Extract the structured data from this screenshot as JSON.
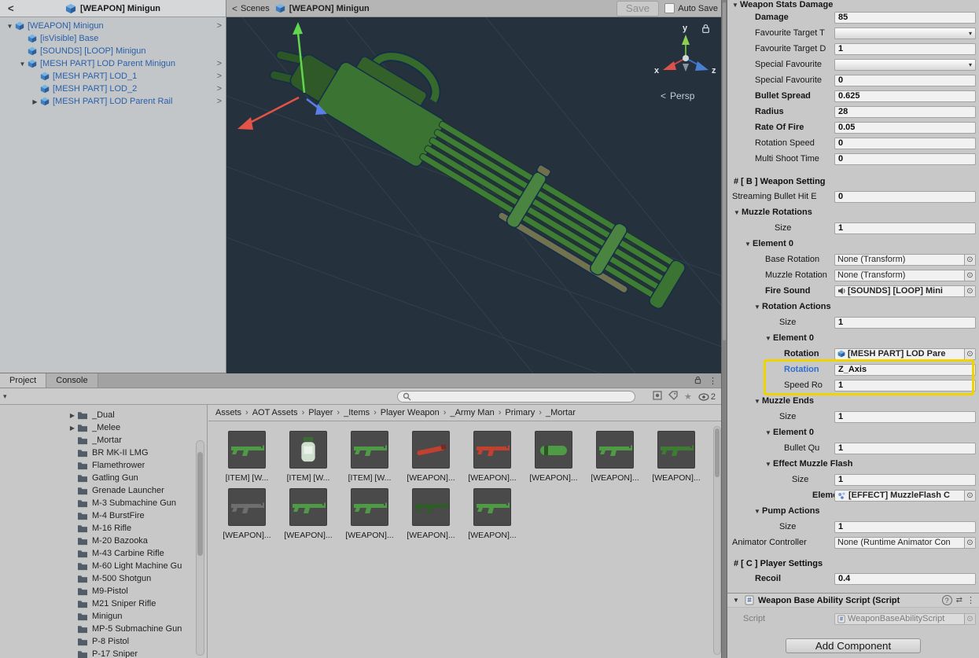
{
  "icons": {
    "foldout_open": "▼",
    "foldout_closed": "▶",
    "chevron_right": "›",
    "back_chevron": "<",
    "row_chevron": ">",
    "kebab": "⋮",
    "star": "★",
    "picker": "⊙",
    "dropdown_arrow": "▾",
    "help": "?",
    "presets": "⇄"
  },
  "colors": {
    "highlight_yellow": "#f0d400",
    "prefab_text_blue": "#2a5fa8",
    "scene_background": "#25313d",
    "model_green": "#3e7c34",
    "axis_x_red": "#e0514d",
    "axis_y_green": "#8ed051",
    "axis_z_blue": "#4a7fd4"
  },
  "hierarchy": {
    "header_title": "[WEAPON] Minigun",
    "items": [
      {
        "label": "[WEAPON] Minigun"
      },
      {
        "label": "[isVisible] Base"
      },
      {
        "label": "[SOUNDS] [LOOP] Minigun"
      },
      {
        "label": "[MESH PART] LOD Parent Minigun"
      },
      {
        "label": "[MESH PART] LOD_1"
      },
      {
        "label": "[MESH PART] LOD_2"
      },
      {
        "label": "[MESH PART] LOD Parent Rail"
      }
    ]
  },
  "scene": {
    "back_label": "Scenes",
    "tab_title": "[WEAPON] Minigun",
    "save_button": "Save",
    "auto_save_label": "Auto Save",
    "auto_save_checked": false,
    "persp_label": "Persp",
    "axis_x": "x",
    "axis_y": "y",
    "axis_z": "z"
  },
  "project": {
    "tab_project": "Project",
    "tab_console": "Console",
    "search_placeholder": "",
    "eye_count": "2",
    "folders": [
      {
        "label": "_Dual"
      },
      {
        "label": "_Melee"
      },
      {
        "label": "_Mortar"
      },
      {
        "label": "BR MK-II LMG"
      },
      {
        "label": "Flamethrower"
      },
      {
        "label": "Gatling Gun"
      },
      {
        "label": "Grenade Launcher"
      },
      {
        "label": "M-3 Submachine Gun"
      },
      {
        "label": "M-4 BurstFire"
      },
      {
        "label": "M-16 Rifle"
      },
      {
        "label": "M-20 Bazooka"
      },
      {
        "label": "M-43 Carbine Rifle"
      },
      {
        "label": "M-60 Light Machine Gu"
      },
      {
        "label": "M-500 Shotgun"
      },
      {
        "label": "M9-Pistol"
      },
      {
        "label": "M21 Sniper Rifle"
      },
      {
        "label": "Minigun"
      },
      {
        "label": "MP-5 Submachine Gun"
      },
      {
        "label": "P-8 Pistol"
      },
      {
        "label": "P-17 Sniper"
      }
    ],
    "breadcrumb": [
      "Assets",
      "AOT Assets",
      "Player",
      "_Items",
      "Player Weapon",
      "_Army Man",
      "Primary",
      "_Mortar"
    ],
    "assets": [
      {
        "label": "[ITEM] [W...",
        "tint": "color:#4f9a44"
      },
      {
        "label": "[ITEM] [W...",
        "tint": "color:#cfe0cf"
      },
      {
        "label": "[ITEM] [W...",
        "tint": "color:#4f9a44"
      },
      {
        "label": "[WEAPON]...",
        "tint": "color:#c2402e"
      },
      {
        "label": "[WEAPON]...",
        "tint": "color:#c2402e"
      },
      {
        "label": "[WEAPON]...",
        "tint": "color:#4f9a44"
      },
      {
        "label": "[WEAPON]...",
        "tint": "color:#4f9a44"
      },
      {
        "label": "[WEAPON]...",
        "tint": "color:#3e7c34"
      },
      {
        "label": "[WEAPON]...",
        "tint": "color:#6e6e6e"
      },
      {
        "label": "[WEAPON]...",
        "tint": "color:#4f9a44"
      },
      {
        "label": "[WEAPON]...",
        "tint": "color:#4f9a44"
      },
      {
        "label": "[WEAPON]...",
        "tint": "color:#2f5c28"
      },
      {
        "label": "[WEAPON]...",
        "tint": "color:#4f9a44"
      }
    ]
  },
  "inspector": {
    "stats_header": "Weapon Stats Damage",
    "damage": {
      "label": "Damage",
      "value": "85"
    },
    "favourite_target_t": {
      "label": "Favourite Target T"
    },
    "favourite_target_d": {
      "label": "Favourite Target D",
      "value": "1"
    },
    "special_favourite_t": {
      "label": "Special Favourite"
    },
    "special_favourite_d": {
      "label": "Special Favourite",
      "value": "0"
    },
    "bullet_spread": {
      "label": "Bullet Spread",
      "value": "0.625"
    },
    "radius": {
      "label": "Radius",
      "value": "28"
    },
    "rate_of_fire": {
      "label": "Rate Of Fire",
      "value": "0.05"
    },
    "rotation_speed": {
      "label": "Rotation Speed",
      "value": "0"
    },
    "multi_shoot_time": {
      "label": "Multi Shoot Time",
      "value": "0"
    },
    "b_section": "# [ B ] Weapon Setting",
    "streaming_bullet": {
      "label": "Streaming Bullet Hit E",
      "value": "0"
    },
    "muzzle_rotations": {
      "label": "Muzzle Rotations",
      "size_label": "Size",
      "size": "1",
      "element0": "Element 0"
    },
    "base_rotation": {
      "label": "Base Rotation",
      "value": "None (Transform)"
    },
    "muzzle_rotation": {
      "label": "Muzzle Rotation",
      "value": "None (Transform)"
    },
    "fire_sound": {
      "label": "Fire Sound",
      "value": "[SOUNDS] [LOOP] Mini"
    },
    "rotation_actions": {
      "label": "Rotation Actions",
      "size_label": "Size",
      "size": "1",
      "element0": "Element 0"
    },
    "rotation_object": {
      "label": "Rotation",
      "value": "[MESH PART] LOD Pare"
    },
    "rotation_axis": {
      "label": "Rotation",
      "value": "Z_Axis"
    },
    "speed_ro": {
      "label": "Speed Ro",
      "value": "1"
    },
    "muzzle_ends": {
      "label": "Muzzle Ends",
      "size_label": "Size",
      "size": "1",
      "element0": "Element 0"
    },
    "bullet_qu": {
      "label": "Bullet Qu",
      "value": "1"
    },
    "effect_muzzle_flash": {
      "label": "Effect Muzzle Flash",
      "size_label": "Size",
      "size": "1"
    },
    "effect_element": {
      "label": "Elemen",
      "value": "[EFFECT] MuzzleFlash C"
    },
    "pump_actions": {
      "label": "Pump Actions",
      "size_label": "Size",
      "size": "1"
    },
    "animator_controller": {
      "label": "Animator Controller",
      "value": "None (Runtime Animator Con"
    },
    "c_section": "# [ C ] Player Settings",
    "recoil": {
      "label": "Recoil",
      "value": "0.4"
    },
    "component_header": "Weapon Base Ability Script (Script",
    "script_row": {
      "label": "Script",
      "value": "WeaponBaseAbilityScript"
    },
    "add_component": "Add Component"
  }
}
